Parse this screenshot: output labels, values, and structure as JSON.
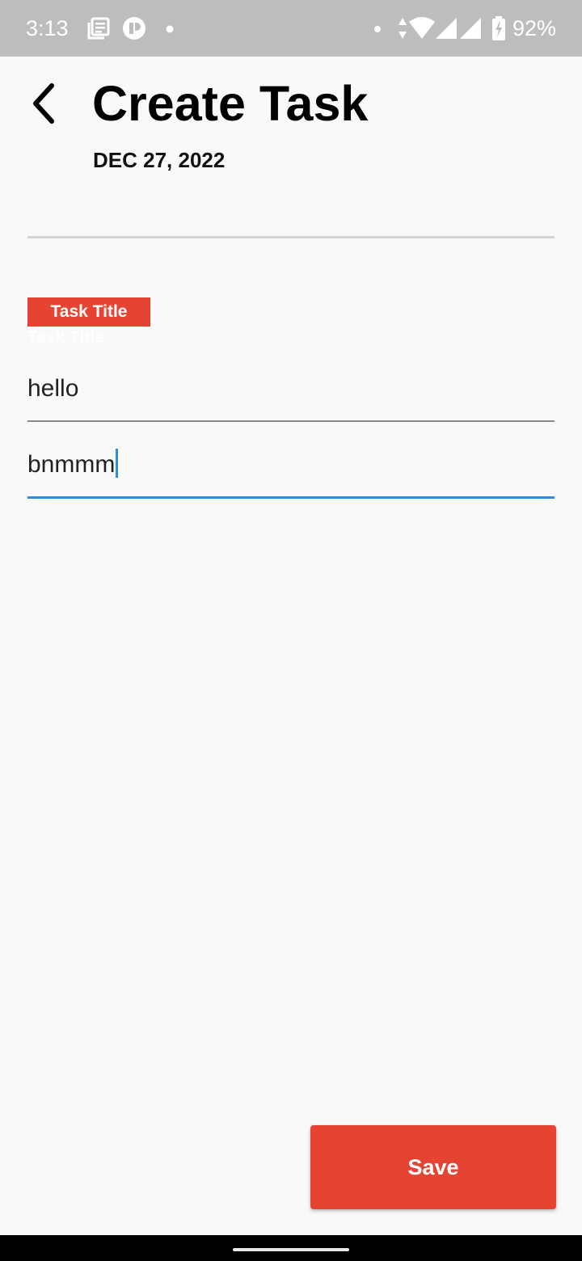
{
  "status_bar": {
    "time": "3:13",
    "battery": "92%",
    "left_icons": [
      "news-icon",
      "app-p-icon",
      "dot-icon"
    ],
    "right_icons": [
      "dot-icon",
      "data-arrows-icon",
      "wifi-icon",
      "signal-icon",
      "signal-icon",
      "battery-charging-icon"
    ],
    "wifi_badge": "4"
  },
  "header": {
    "back_icon": "chevron-left-icon",
    "title": "Create Task",
    "date": "DEC 27, 2022"
  },
  "form": {
    "section_label": "Task Title",
    "ghost_label": "Task Title",
    "title_value": "hello",
    "description_value": "bnmmm"
  },
  "actions": {
    "save_label": "Save"
  },
  "colors": {
    "accent": "#e64433",
    "focus": "#2a8ce5",
    "background": "#f9f9f9",
    "status_bar": "#bdbdbd"
  }
}
